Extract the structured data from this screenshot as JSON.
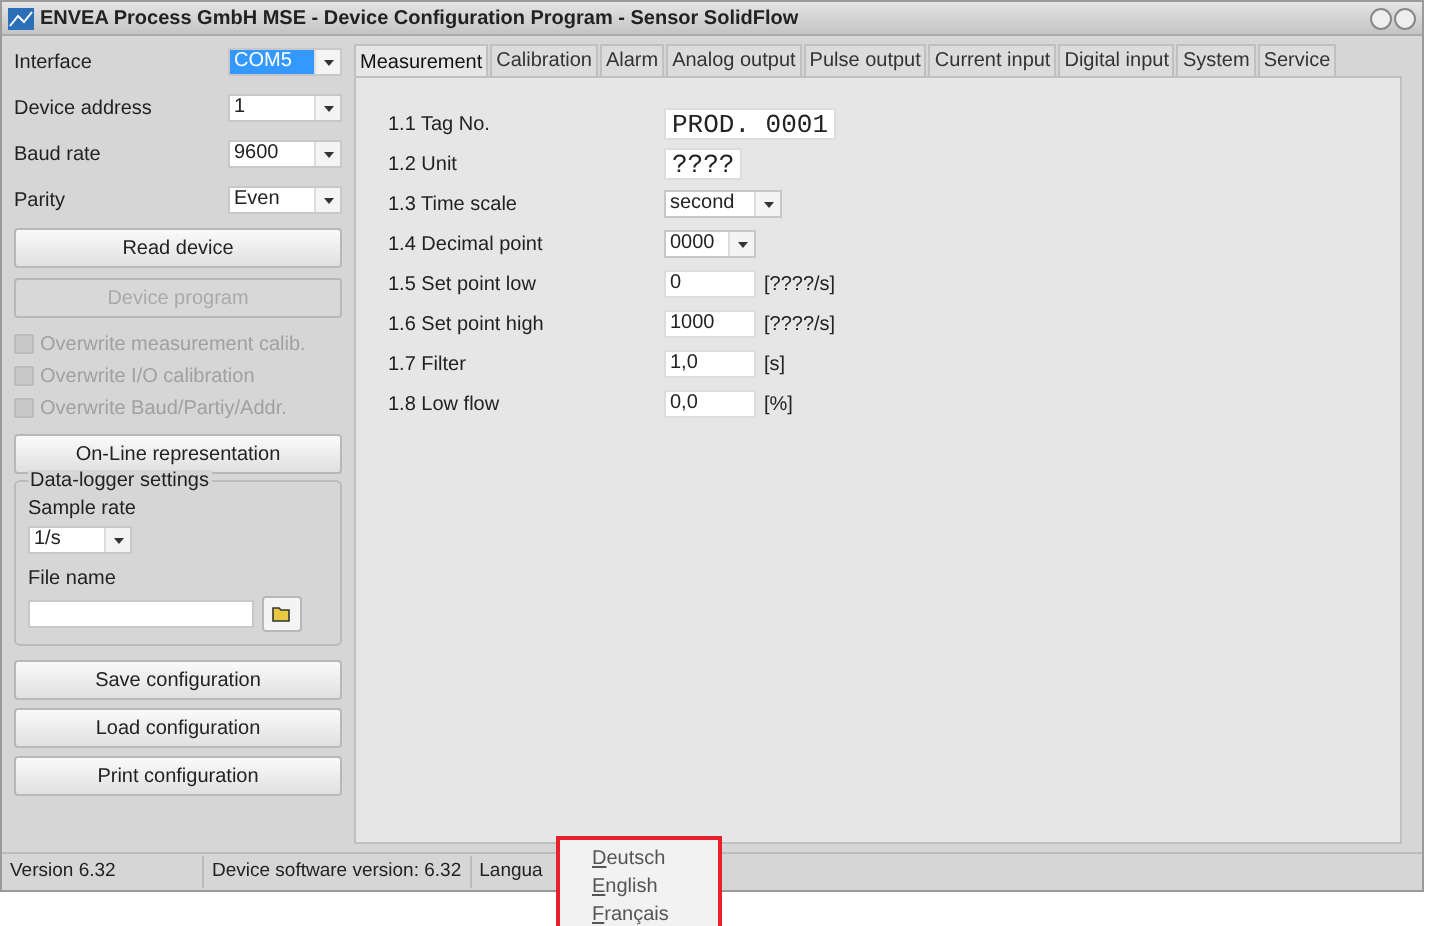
{
  "window": {
    "title": "ENVEA Process GmbH MSE - Device Configuration Program - Sensor SolidFlow"
  },
  "connection": [
    {
      "label": "Interface",
      "value": "COM5",
      "selected": true
    },
    {
      "label": "Device address",
      "value": "1",
      "selected": false
    },
    {
      "label": "Baud rate",
      "value": "9600",
      "selected": false
    },
    {
      "label": "Parity",
      "value": "Even",
      "selected": false
    }
  ],
  "read_button": {
    "label": "Read device",
    "disabled": false
  },
  "program_button": {
    "label": "Device program",
    "disabled": true
  },
  "overwrite_options": [
    {
      "label": "Overwrite measurement calib.",
      "checked": false,
      "disabled": true
    },
    {
      "label": "Overwrite I/O calibration",
      "checked": false,
      "disabled": true
    },
    {
      "label": "Overwrite Baud/Partiy/Addr.",
      "checked": false,
      "disabled": true
    }
  ],
  "online_button": "On-Line representation",
  "datalogger": {
    "title": "Data-logger settings",
    "sample_rate_label": "Sample rate",
    "sample_rate": "1/s",
    "file_name_label": "File name"
  },
  "config_buttons": [
    "Save configuration",
    "Load configuration",
    "Print configuration"
  ],
  "tabs": [
    {
      "label": "Measurement",
      "selected": true
    },
    {
      "label": "Calibration",
      "selected": false
    },
    {
      "label": "Alarm",
      "selected": false
    },
    {
      "label": "Analog output",
      "selected": false
    },
    {
      "label": "Pulse output",
      "selected": false
    },
    {
      "label": "Current input",
      "selected": false
    },
    {
      "label": "Digital input",
      "selected": false
    },
    {
      "label": "System",
      "selected": false
    },
    {
      "label": "Service",
      "selected": false
    }
  ],
  "fields": [
    {
      "label": "1.1 Tag No.",
      "kind": "mono",
      "value": "PROD. 0001"
    },
    {
      "label": "1.2 Unit",
      "kind": "mono",
      "value": "????"
    },
    {
      "label": "1.3 Time scale",
      "kind": "select",
      "value": "second"
    },
    {
      "label": "1.4 Decimal point",
      "kind": "select",
      "value": "0000"
    },
    {
      "label": "1.5 Set point low",
      "kind": "text",
      "value": "0",
      "unit": "[????/s]"
    },
    {
      "label": "1.6 Set point high",
      "kind": "text",
      "value": "1000",
      "unit": "[????/s]"
    },
    {
      "label": "1.7 Filter",
      "kind": "text",
      "value": "1,0",
      "unit": "[s]"
    },
    {
      "label": "1.8 Low flow",
      "kind": "text",
      "value": "0,0",
      "unit": "[%]"
    }
  ],
  "status_bar": {
    "version": "Version 6.32",
    "device_version": "Device software version: 6.32",
    "language": "Langua"
  },
  "language_menu": [
    "Deutsch",
    "English",
    "Français"
  ]
}
